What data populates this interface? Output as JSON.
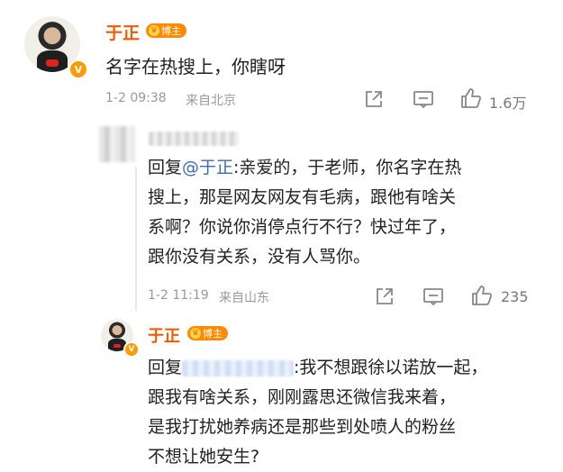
{
  "comment1": {
    "author": "于正",
    "badge": "博主",
    "vbadge": "V",
    "text": "名字在热搜上，你瞎呀",
    "time": "1-2 09:38",
    "location": "来自北京",
    "likes": "1.6万"
  },
  "reply1": {
    "reply_prefix": "回复",
    "mention": "@于正",
    "text_line1": ":亲爱的，于老师，你名字在热",
    "text_line2": "搜上，那是网友网友有毛病，跟他有啥关",
    "text_line3": "系啊？你说你消停点行不行？快过年了，",
    "text_line4": "跟你没有关系，没有人骂你。",
    "time": "1-2 11:19",
    "location": "来自山东",
    "likes": "235"
  },
  "reply2": {
    "author": "于正",
    "badge": "博主",
    "vbadge": "V",
    "reply_prefix": "回复",
    "text_line1": ":我不想跟徐以诺放一起，",
    "text_line2": "跟我有啥关系，刚刚露思还微信我来着，",
    "text_line3": "是我打扰她养病还是那些到处喷人的粉丝",
    "text_line4": "不想让她安生?"
  },
  "icons": {
    "share": "share-icon",
    "comment": "comment-icon",
    "like": "thumbs-up-icon"
  },
  "colors": {
    "author_name": "#f05a00",
    "badge": "#ff8a00",
    "mention": "#3a6bb6",
    "meta": "#999999"
  }
}
